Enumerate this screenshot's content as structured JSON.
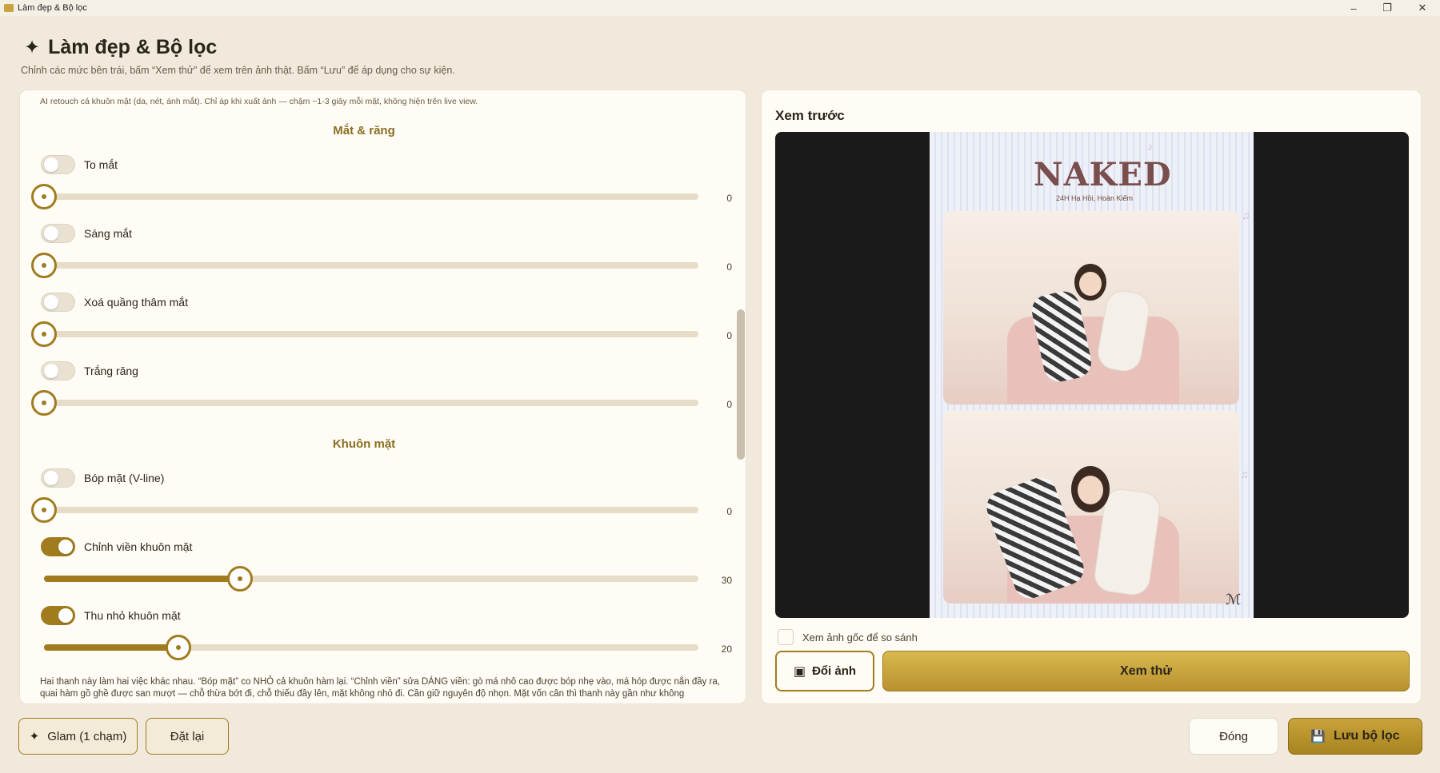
{
  "window": {
    "title": "Làm đẹp & Bộ lọc",
    "controls": {
      "minimize": "–",
      "restore": "❐",
      "close": "✕"
    }
  },
  "header": {
    "icon": "sparkle-icon",
    "title": "Làm đẹp & Bộ lọc",
    "subtitle": "Chỉnh các mức bên trái, bấm “Xem thử” để xem trên ảnh thật. Bấm “Lưu” để áp dụng cho sự kiện."
  },
  "left": {
    "ai_note": "AI retouch cả khuôn mặt (da, nét, ánh mắt). Chỉ áp khi xuất ảnh — chậm ~1-3 giây mỗi mặt, không hiện trên live view.",
    "sections": [
      {
        "title": "Mắt & răng"
      },
      {
        "title": "Khuôn mặt"
      }
    ],
    "options": [
      {
        "label": "To mắt",
        "on": false,
        "value": "0"
      },
      {
        "label": "Sáng mắt",
        "on": false,
        "value": "0"
      },
      {
        "label": "Xoá quầng thâm mắt",
        "on": false,
        "value": "0"
      },
      {
        "label": "Trắng răng",
        "on": false,
        "value": "0"
      },
      {
        "label": "Bóp mặt (V-line)",
        "on": false,
        "value": "0"
      },
      {
        "label": "Chỉnh viền khuôn mặt",
        "on": true,
        "value": "30"
      },
      {
        "label": "Thu nhỏ khuôn mặt",
        "on": true,
        "value": "20"
      }
    ],
    "footnote": "Hai thanh này làm hai việc khác nhau. “Bóp mặt” co NHỎ cả khuôn hàm lại. “Chỉnh viền” sửa DÁNG viền: gò má nhô cao được bóp nhẹ vào, má hóp được nắn đầy ra, quai hàm gồ ghề được san mượt — chỗ thừa bớt đi, chỗ thiếu đầy lên, mặt không nhỏ đi. Cần giữ nguyên độ nhọn. Mặt vốn cân thì thanh này gần như không"
  },
  "preview": {
    "title": "Xem trước",
    "brand": "NAKED",
    "brand_sub": "24H Hạ Hồi, Hoàn Kiếm",
    "compare_label": "Xem ảnh gốc để so sánh",
    "swap_label": "Đổi ảnh",
    "try_label": "Xem thử"
  },
  "footer": {
    "glam_label": "Glam (1 chạm)",
    "reset_label": "Đặt lại",
    "close_label": "Đóng",
    "save_label": "Lưu bộ lọc"
  },
  "colors": {
    "accent": "#a07c1e",
    "background": "#f0e9dc",
    "panel": "#fffcf5"
  }
}
